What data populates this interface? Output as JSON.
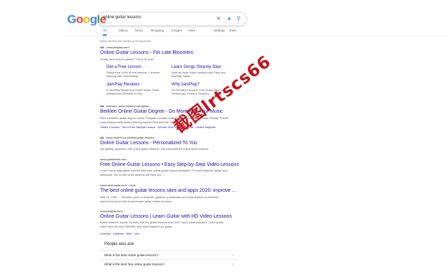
{
  "search": {
    "query": "online guitar lessons"
  },
  "tabs": [
    "All",
    "Videos",
    "News",
    "Shopping",
    "Images",
    "More"
  ],
  "tools": {
    "settings": "Settings",
    "tools": "Tools"
  },
  "stats": "About 86,000,000 results (0.52 seconds)",
  "results": [
    {
      "ad_label": "Ad",
      "url": "www.jamplay.com/",
      "title": "Online Guitar Lessons - For Late Bloomers",
      "desc": "Finally have time for guitar? This is for you!",
      "sitelinks": [
        {
          "title": "Get a Free Lesson",
          "desc": "Select from 100's of free lessons. Continue learning with membership."
        },
        {
          "title": "Learn Songs Step-by-Step",
          "desc": "Note-for-Note Video Lessons with Tabs and Backing Tracks"
        },
        {
          "title": "JamPlay Reviews",
          "desc": "Is JamPlay Really Any Good? Read These Independent Reviews to See"
        },
        {
          "title": "Why JamPlay?",
          "desc": "On Demand Lessons, Live Guitar Q&A Live Workshops, Famous Teachers"
        }
      ]
    },
    {
      "ad_label": "Ad",
      "url": "welcome.online.berklee.edu/guitar",
      "title": "Berklee Online Guitar Degree - Do More with Your Music",
      "desc": "Earn a Berklee guitar degree online. Program includes extensive hands-on World Class Faculty. Private Lessons(included) Award-Winning Alumni Financial Aid. Flexible.",
      "links": "Online Courses · Get a Free Sample Lesson · Devote Your Career to Music · Online Degrees"
    },
    {
      "ad_label": "Ad",
      "url": "www.truefire.com/online/guitar-lessons",
      "title": "Online Guitar Lessons - Personalized To You",
      "desc": "Not getting anywhere with online guitar lessons? Get personalized online guitar lessons"
    },
    {
      "url": "www.guitartricks.com",
      "title": "Free Online Guitar Lessons • Easy Step-by-Step Video Lessons",
      "desc": "Learn how to play guitar with the best free online guitar lessons available. For both beginner guitar and advanced, our 11,000 video lessons will have you ..."
    },
    {
      "url": "www.musicradar.com › news",
      "title": "The best online guitar lessons sites and apps 2020: improve ...",
      "desc": "May 12, 2020 — Whether you're a beginner guitarist, a seasoned pro or somewhere in between, improve at home with these remote guitar lesson services."
    },
    {
      "url": "www.jamplay.com",
      "title": "Online Guitar Lessons | Learn Guitar with HD Video Lessons",
      "desc": "Guitar lessons, master courses and live guitar lessons from 100+ world-class teachers. Learn guitar online and join over 500000+ who have enjoyed our guitar ...",
      "links": "Lessons · Libraries · New · Live"
    }
  ],
  "paa": {
    "heading": "People also ask",
    "questions": [
      "What is the best online guitar lessons?",
      "What is the best free online guitar lessons?"
    ]
  },
  "stamp": "截图lrtscs66"
}
